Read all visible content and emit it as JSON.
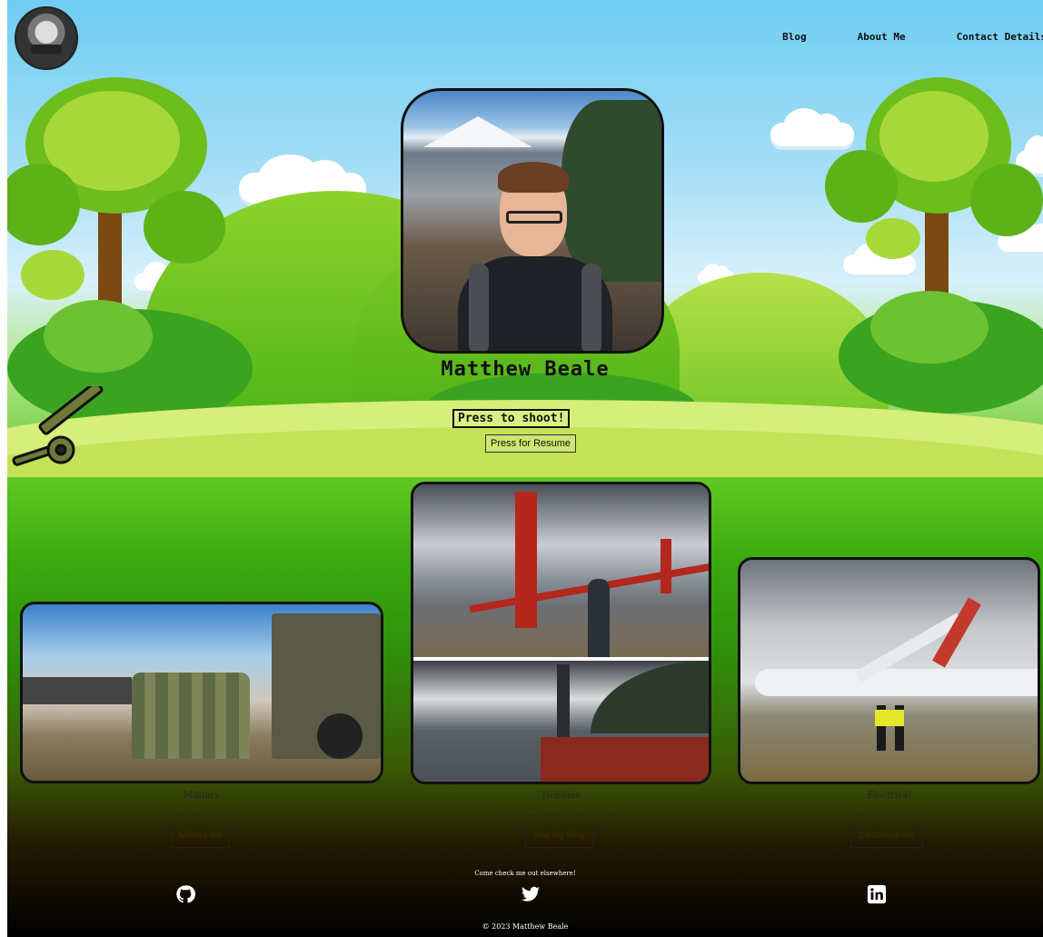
{
  "header": {
    "nav": [
      {
        "label": "Blog"
      },
      {
        "label": "About Me"
      },
      {
        "label": "Contact Details"
      }
    ]
  },
  "hero": {
    "name": "Matthew Beale",
    "shoot_label": "Press to shoot!",
    "resume_label": "Press for Resume"
  },
  "cards": [
    {
      "title": "Military",
      "subtitle": "My military journey",
      "button": "Military life"
    },
    {
      "title": "Hobbies",
      "subtitle": "As you can probably tell, I love to travel!",
      "button": "See My Blog"
    },
    {
      "title": "Electrical",
      "subtitle": "My more recent journey",
      "button": "Electrician life"
    }
  ],
  "footer": {
    "tagline": "Come check me out elsewhere!",
    "social": [
      "github-icon",
      "twitter-icon",
      "linkedin-icon"
    ],
    "copyright": "© 2023 Matthew Beale"
  },
  "colors": {
    "sky": "#6fcdf2",
    "grass": "#5cc41e",
    "ground": "#d6ee7a",
    "footer": "#000000"
  }
}
